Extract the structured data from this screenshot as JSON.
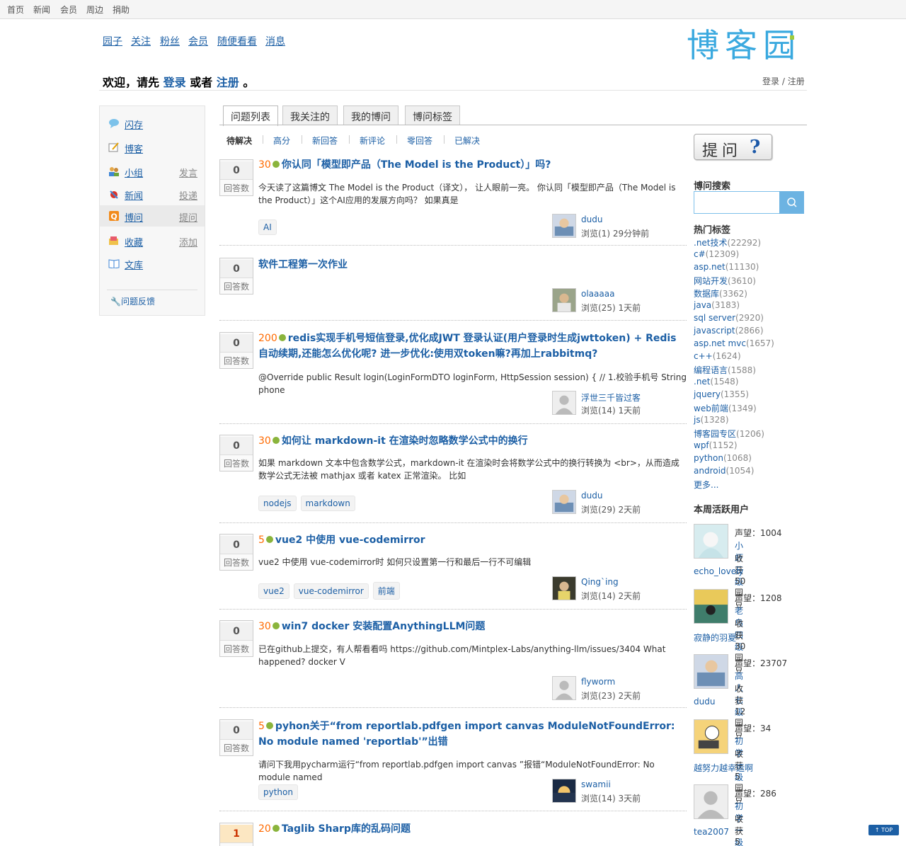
{
  "topbar": {
    "items": [
      "首页",
      "新闻",
      "会员",
      "周边",
      "捐助"
    ]
  },
  "mainnav": {
    "items": [
      "园子",
      "关注",
      "粉丝",
      "会员",
      "随便看看",
      "消息"
    ]
  },
  "logo": {
    "text": "博客园"
  },
  "welcome": {
    "prefix": "欢迎，请先",
    "login": "登录",
    "or": "或者",
    "register": "注册",
    "suffix": "。"
  },
  "toplogin": {
    "login": "登录",
    "sep": " / ",
    "register": "注册"
  },
  "sidebar": {
    "items": [
      {
        "label": "闪存",
        "action": "",
        "icon": "chat-bubble-icon"
      },
      {
        "label": "博客",
        "action": "",
        "icon": "notepad-icon"
      },
      {
        "label": "小组",
        "action": "发言",
        "icon": "group-icon"
      },
      {
        "label": "新闻",
        "action": "投递",
        "icon": "news-icon"
      },
      {
        "label": "博问",
        "action": "提问",
        "icon": "question-icon"
      },
      {
        "label": "收藏",
        "action": "添加",
        "icon": "bookmark-icon"
      },
      {
        "label": "文库",
        "action": "",
        "icon": "book-icon"
      }
    ],
    "feedback": "问题反馈"
  },
  "tabs": [
    "问题列表",
    "我关注的",
    "我的博问",
    "博问标签"
  ],
  "filters": [
    "待解决",
    "高分",
    "新回答",
    "新评论",
    "零回答",
    "已解决"
  ],
  "answer_label": "回答数",
  "questions": [
    {
      "count": "0",
      "bounty": "30",
      "title": "你认同「模型即产品（The Model is the Product）」吗?",
      "summary": "今天读了这篇博文 The Model is the Product（译文）， 让人眼前一亮。 你认同「模型即产品（The Model is the Product）」这个AI应用的发展方向吗？ 如果真是",
      "tags": [
        "AI"
      ],
      "user": "dudu",
      "views": "浏览(1) 29分钟前"
    },
    {
      "count": "0",
      "bounty": "",
      "title": "软件工程第一次作业",
      "summary": "",
      "tags": [],
      "user": "olaaaaa",
      "views": "浏览(25) 1天前"
    },
    {
      "count": "0",
      "bounty": "200",
      "title": "redis实现手机号短信登录,优化成JWT 登录认证(用户登录时生成jwttoken) + Redis 自动续期,还能怎么优化呢? 进一步优化:使用双token嘛?再加上rabbitmq?",
      "summary": "@Override public Result login(LoginFormDTO loginForm, HttpSession session) { // 1.校验手机号 String phone",
      "tags": [],
      "user": "浮世三千皆过客",
      "views": "浏览(14) 1天前"
    },
    {
      "count": "0",
      "bounty": "30",
      "title": "如何让 markdown-it 在渲染时忽略数学公式中的换行",
      "summary": "如果 markdown 文本中包含数学公式，markdown-it 在渲染时会将数学公式中的换行转换为 <br>，从而造成数学公式无法被 mathjax 或者 katex 正常渲染。 比如",
      "tags": [
        "nodejs",
        "markdown"
      ],
      "user": "dudu",
      "views": "浏览(29) 2天前"
    },
    {
      "count": "0",
      "bounty": "5",
      "title": "vue2 中使用 vue-codemirror",
      "summary": "vue2 中使用 vue-codemirror时 如何只设置第一行和最后一行不可编辑",
      "tags": [
        "vue2",
        "vue-codemirror",
        "前端"
      ],
      "user": "Qing`ing",
      "views": "浏览(14) 2天前"
    },
    {
      "count": "0",
      "bounty": "30",
      "title": "win7 docker 安装配置AnythingLLM问题",
      "summary": "已在github上提交，有人帮看看吗 https://github.com/Mintplex-Labs/anything-llm/issues/3404 What happened? docker V",
      "tags": [],
      "user": "flyworm",
      "views": "浏览(23) 2天前"
    },
    {
      "count": "0",
      "bounty": "5",
      "title": "pyhon关于“from reportlab.pdfgen import canvas ModuleNotFoundError: No module named 'reportlab'”出错",
      "summary": "请问下我用pycharm运行“from reportlab.pdfgen import canvas ”报错“ModuleNotFoundError: No module named",
      "tags": [
        "python"
      ],
      "user": "swamii",
      "views": "浏览(14) 3天前"
    },
    {
      "count": "1",
      "bounty": "20",
      "title": "Taglib Sharp库的乱码问题",
      "summary": "",
      "tags": [],
      "user": "",
      "views": ""
    }
  ],
  "ask_button": {
    "text": "提问",
    "mark": "?"
  },
  "search": {
    "title": "博问搜索",
    "placeholder": ""
  },
  "hot_tags": {
    "title": "热门标签",
    "items": [
      {
        "name": ".net技术",
        "count": "(22292)"
      },
      {
        "name": "c#",
        "count": "(12309)"
      },
      {
        "name": "asp.net",
        "count": "(11130)"
      },
      {
        "name": "网站开发",
        "count": "(3610)"
      },
      {
        "name": "数据库",
        "count": "(3362)"
      },
      {
        "name": "java",
        "count": "(3183)"
      },
      {
        "name": "sql server",
        "count": "(2920)"
      },
      {
        "name": "javascript",
        "count": "(2866)"
      },
      {
        "name": "asp.net mvc",
        "count": "(1657)"
      },
      {
        "name": "c++",
        "count": "(1624)"
      },
      {
        "name": "编程语言",
        "count": "(1588)"
      },
      {
        "name": ".net",
        "count": "(1548)"
      },
      {
        "name": "jquery",
        "count": "(1355)"
      },
      {
        "name": "web前端",
        "count": "(1349)"
      },
      {
        "name": "js",
        "count": "(1328)"
      },
      {
        "name": "博客园专区",
        "count": "(1206)"
      },
      {
        "name": "wpf",
        "count": "(1152)"
      },
      {
        "name": "python",
        "count": "(1068)"
      },
      {
        "name": "android",
        "count": "(1054)"
      }
    ],
    "more": "更多..."
  },
  "active_users": {
    "title": "本周活跃用户",
    "items": [
      {
        "rep": "声望：1004",
        "level": "小虾三级",
        "beans": "收获50园豆",
        "name": "echo_lovely"
      },
      {
        "rep": "声望：1208",
        "level": "老鸟四级",
        "beans": "收获30园豆",
        "name": "寂静的羽夏"
      },
      {
        "rep": "声望：23707",
        "level": "高人七级",
        "beans": "收获12园豆",
        "name": "dudu"
      },
      {
        "rep": "声望：34",
        "level": "初学一级",
        "beans": "收获5园豆",
        "name": "越努力越幸运啊"
      },
      {
        "rep": "声望：286",
        "level": "初学一级",
        "beans": "收获5园豆",
        "name": "tea2007"
      }
    ]
  },
  "totop": "↑ TOP"
}
